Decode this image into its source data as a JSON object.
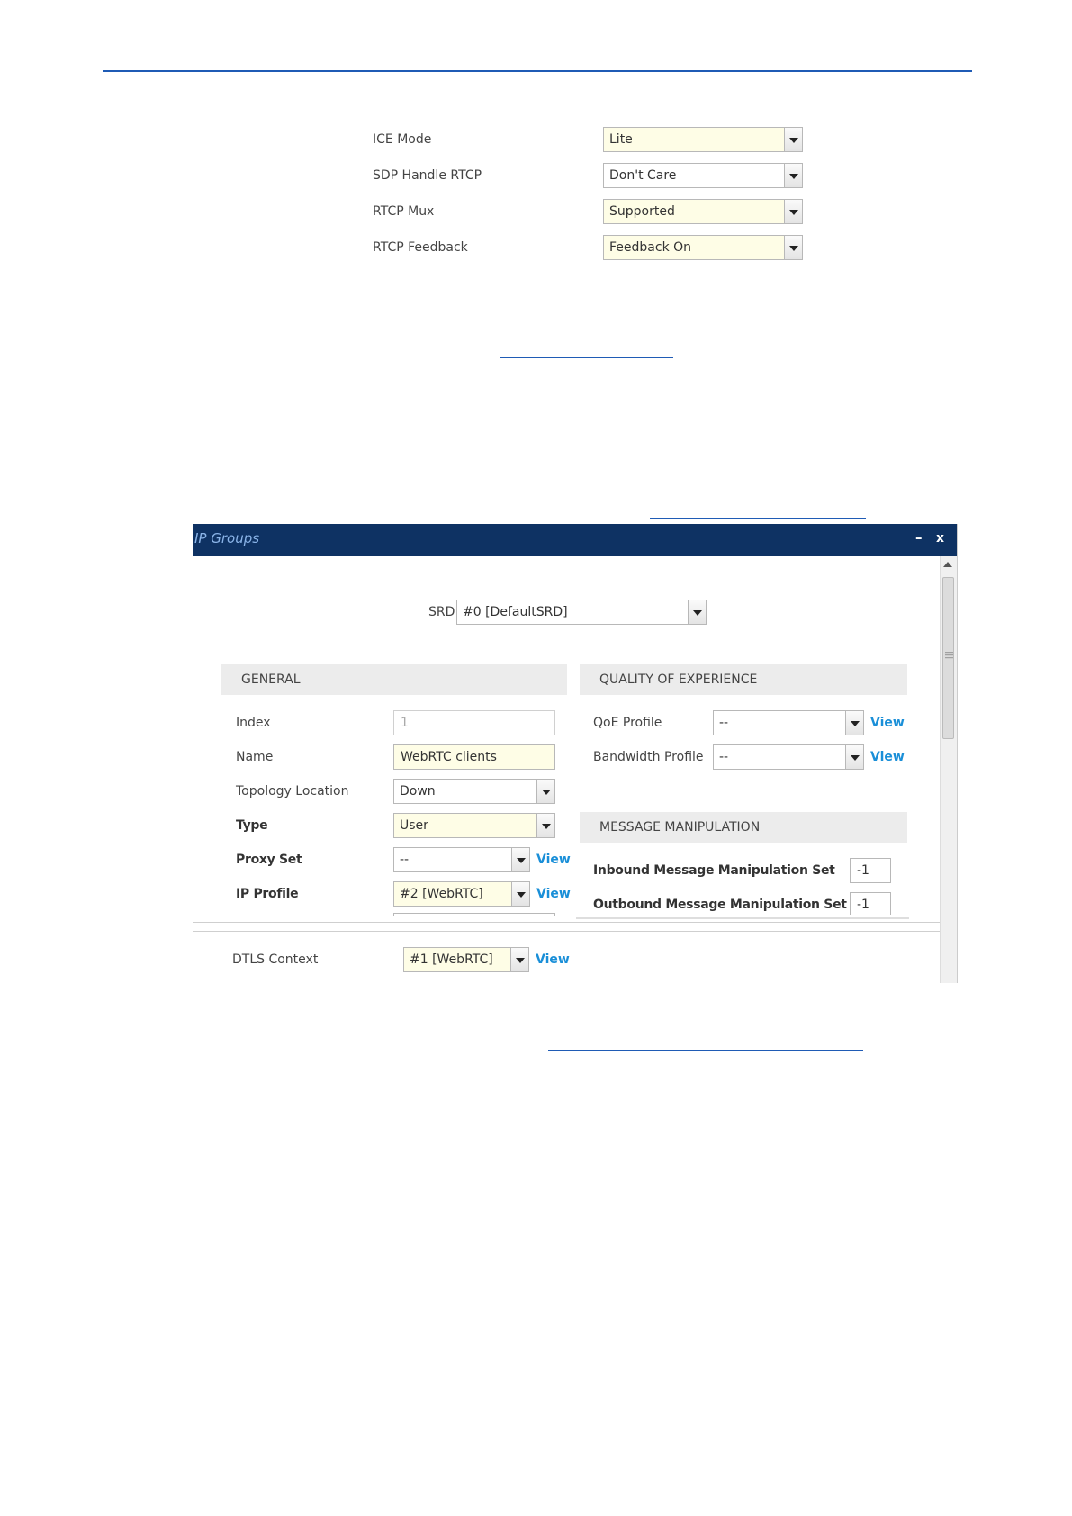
{
  "top_form": {
    "rows": [
      {
        "label": "ICE Mode",
        "value": "Lite"
      },
      {
        "label": "SDP Handle RTCP",
        "value": "Don't Care"
      },
      {
        "label": "RTCP Mux",
        "value": "Supported"
      },
      {
        "label": "RTCP Feedback",
        "value": "Feedback On"
      }
    ]
  },
  "dialog": {
    "title": "IP Groups",
    "minimize_label": "–",
    "close_label": "x",
    "srd": {
      "label": "SRD",
      "value": "#0 [DefaultSRD]"
    },
    "general": {
      "header": "GENERAL",
      "index": {
        "label": "Index",
        "value": "1"
      },
      "name": {
        "label": "Name",
        "value": "WebRTC clients"
      },
      "topology": {
        "label": "Topology Location",
        "value": "Down"
      },
      "type": {
        "label": "Type",
        "value": "User"
      },
      "proxy_set": {
        "label": "Proxy Set",
        "value": "--",
        "view": "View"
      },
      "ip_profile": {
        "label": "IP Profile",
        "value": "#2 [WebRTC]",
        "view": "View"
      }
    },
    "qoe": {
      "header": "QUALITY OF EXPERIENCE",
      "qoe_profile": {
        "label": "QoE Profile",
        "value": "--",
        "view": "View"
      },
      "bandwidth_profile": {
        "label": "Bandwidth Profile",
        "value": "--",
        "view": "View"
      }
    },
    "manipulation": {
      "header": "MESSAGE MANIPULATION",
      "inbound": {
        "label": "Inbound Message Manipulation Set",
        "value": "-1"
      },
      "outbound": {
        "label": "Outbound Message Manipulation Set",
        "value": "-1"
      }
    },
    "dtls": {
      "label": "DTLS Context",
      "value": "#1 [WebRTC]",
      "view": "View"
    }
  }
}
